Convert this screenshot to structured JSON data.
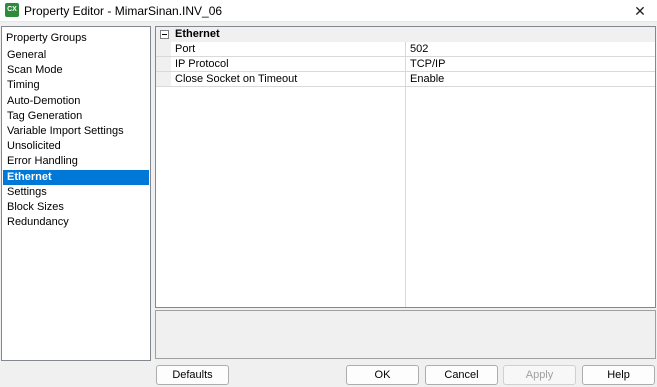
{
  "window": {
    "title": "Property Editor - MimarSinan.INV_06",
    "icon_label": "CX",
    "close_glyph": "✕"
  },
  "groups": {
    "header": "Property Groups",
    "items": [
      {
        "label": "General"
      },
      {
        "label": "Scan Mode"
      },
      {
        "label": "Timing"
      },
      {
        "label": "Auto-Demotion"
      },
      {
        "label": "Tag Generation"
      },
      {
        "label": "Variable Import Settings"
      },
      {
        "label": "Unsolicited"
      },
      {
        "label": "Error Handling"
      },
      {
        "label": "Ethernet",
        "selected": true
      },
      {
        "label": "Settings"
      },
      {
        "label": "Block Sizes"
      },
      {
        "label": "Redundancy"
      }
    ]
  },
  "grid": {
    "category": "Ethernet",
    "rows": [
      {
        "name": "Port",
        "value": "502"
      },
      {
        "name": "IP Protocol",
        "value": "TCP/IP"
      },
      {
        "name": "Close Socket on Timeout",
        "value": "Enable"
      }
    ]
  },
  "buttons": {
    "defaults": "Defaults",
    "ok": "OK",
    "cancel": "Cancel",
    "apply": "Apply",
    "help": "Help"
  },
  "colors": {
    "selection": "#0078d7",
    "app_icon": "#2e8b3a"
  }
}
